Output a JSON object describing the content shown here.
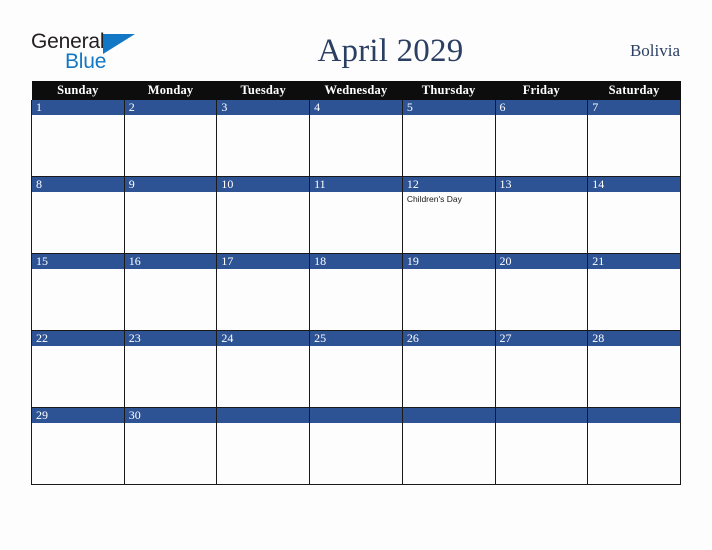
{
  "brand": {
    "name_part1": "General",
    "name_part2": "Blue",
    "accent_color": "#1277c4",
    "text_color": "#231f20"
  },
  "header": {
    "title": "April 2029",
    "country": "Bolivia",
    "title_color": "#2b3f63"
  },
  "calendar": {
    "header_bg": "#0d0d0d",
    "daynum_bg": "#2e5395",
    "weekdays": [
      "Sunday",
      "Monday",
      "Tuesday",
      "Wednesday",
      "Thursday",
      "Friday",
      "Saturday"
    ],
    "weeks": [
      [
        {
          "day": "1",
          "events": []
        },
        {
          "day": "2",
          "events": []
        },
        {
          "day": "3",
          "events": []
        },
        {
          "day": "4",
          "events": []
        },
        {
          "day": "5",
          "events": []
        },
        {
          "day": "6",
          "events": []
        },
        {
          "day": "7",
          "events": []
        }
      ],
      [
        {
          "day": "8",
          "events": []
        },
        {
          "day": "9",
          "events": []
        },
        {
          "day": "10",
          "events": []
        },
        {
          "day": "11",
          "events": []
        },
        {
          "day": "12",
          "events": [
            "Children's Day"
          ]
        },
        {
          "day": "13",
          "events": []
        },
        {
          "day": "14",
          "events": []
        }
      ],
      [
        {
          "day": "15",
          "events": []
        },
        {
          "day": "16",
          "events": []
        },
        {
          "day": "17",
          "events": []
        },
        {
          "day": "18",
          "events": []
        },
        {
          "day": "19",
          "events": []
        },
        {
          "day": "20",
          "events": []
        },
        {
          "day": "21",
          "events": []
        }
      ],
      [
        {
          "day": "22",
          "events": []
        },
        {
          "day": "23",
          "events": []
        },
        {
          "day": "24",
          "events": []
        },
        {
          "day": "25",
          "events": []
        },
        {
          "day": "26",
          "events": []
        },
        {
          "day": "27",
          "events": []
        },
        {
          "day": "28",
          "events": []
        }
      ],
      [
        {
          "day": "29",
          "events": []
        },
        {
          "day": "30",
          "events": []
        },
        {
          "day": "",
          "events": []
        },
        {
          "day": "",
          "events": []
        },
        {
          "day": "",
          "events": []
        },
        {
          "day": "",
          "events": []
        },
        {
          "day": "",
          "events": []
        }
      ]
    ]
  }
}
